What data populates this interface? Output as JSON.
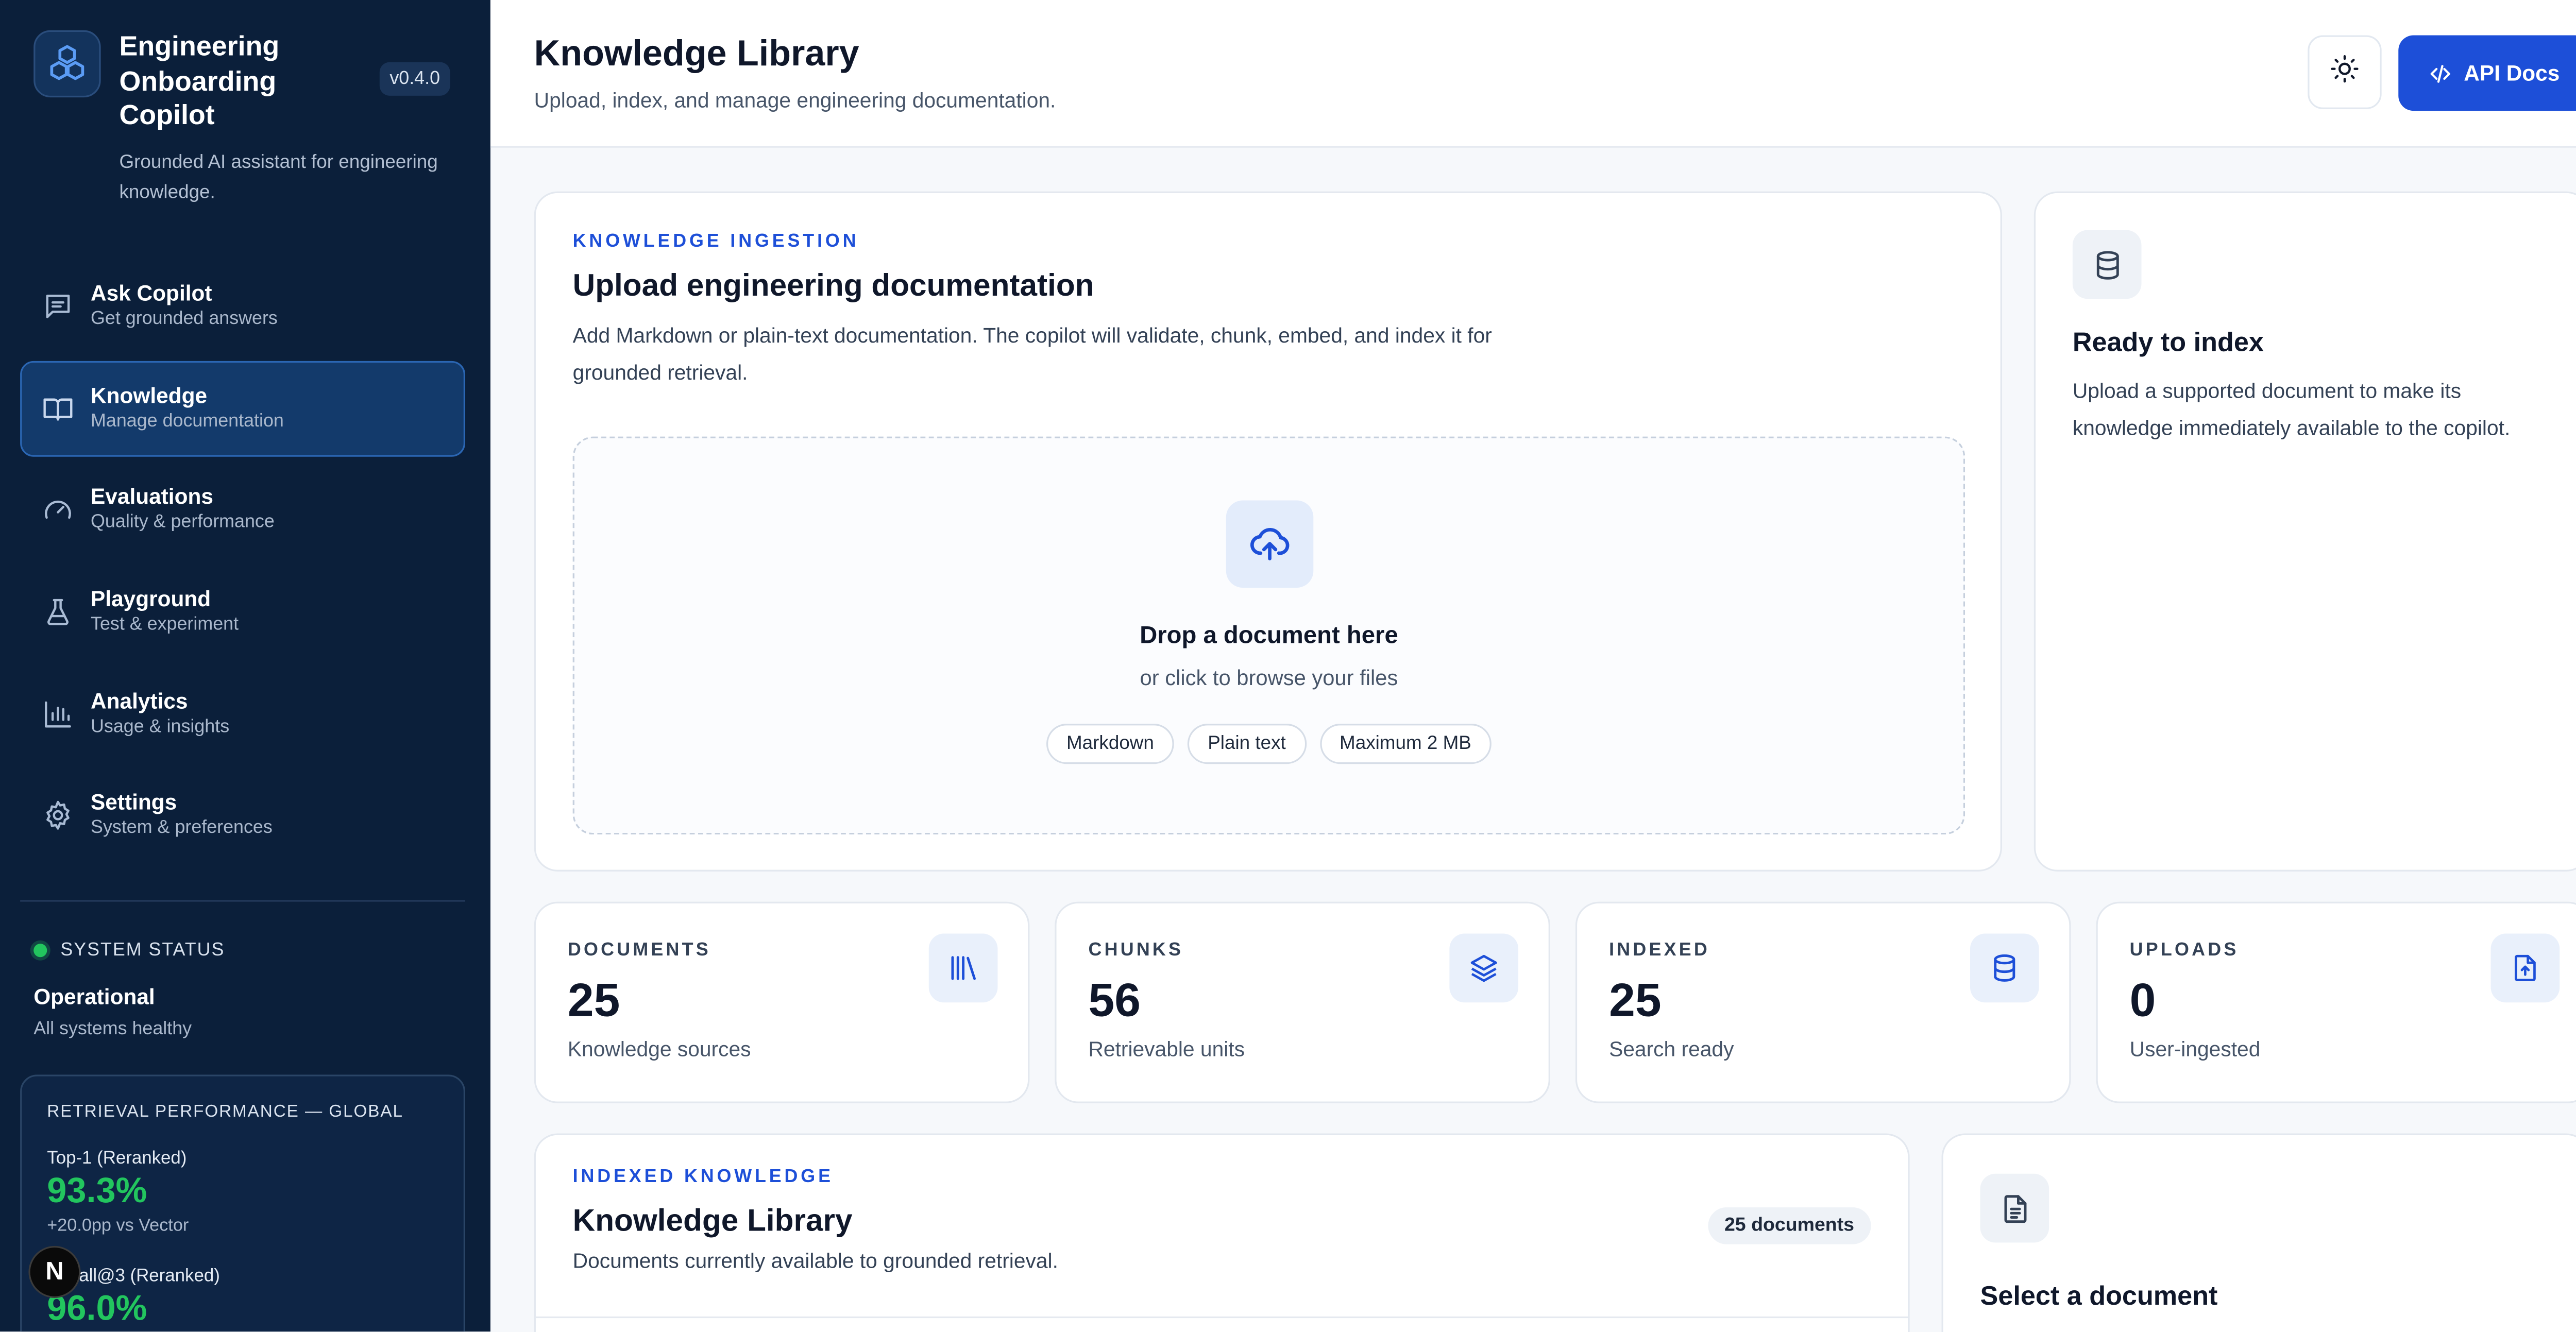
{
  "sidebar": {
    "app_title": "Engineering Onboarding Copilot",
    "version": "v0.4.0",
    "app_subtitle": "Grounded AI assistant for engineering knowledge.",
    "nav": [
      {
        "label": "Ask Copilot",
        "sub": "Get grounded answers",
        "icon": "chat-icon",
        "active": false
      },
      {
        "label": "Knowledge",
        "sub": "Manage documentation",
        "icon": "book-icon",
        "active": true
      },
      {
        "label": "Evaluations",
        "sub": "Quality & performance",
        "icon": "gauge-icon",
        "active": false
      },
      {
        "label": "Playground",
        "sub": "Test & experiment",
        "icon": "flask-icon",
        "active": false
      },
      {
        "label": "Analytics",
        "sub": "Usage & insights",
        "icon": "bar-chart-icon",
        "active": false
      },
      {
        "label": "Settings",
        "sub": "System & preferences",
        "icon": "gear-icon",
        "active": false
      }
    ],
    "status": {
      "heading": "SYSTEM STATUS",
      "value": "Operational",
      "detail": "All systems healthy",
      "color": "#22c55e"
    },
    "performance": {
      "title": "RETRIEVAL PERFORMANCE — GLOBAL",
      "metric1_label": "Top-1 (Reranked)",
      "metric1_value": "93.3%",
      "metric1_note": "+20.0pp vs Vector",
      "metric2_label": "Recall@3 (Reranked)",
      "metric2_value": "96.0%"
    },
    "badge_letter": "N"
  },
  "header": {
    "title": "Knowledge Library",
    "subtitle": "Upload, index, and manage engineering documentation.",
    "api_docs_label": "API Docs",
    "theme_icon": "sun-icon"
  },
  "upload": {
    "eyebrow": "KNOWLEDGE INGESTION",
    "title": "Upload engineering documentation",
    "description": "Add Markdown or plain-text documentation. The copilot will validate, chunk, embed, and index it for grounded retrieval.",
    "drop_title": "Drop a document here",
    "drop_sub": "or click to browse your files",
    "chips": [
      "Markdown",
      "Plain text",
      "Maximum 2 MB"
    ]
  },
  "ready": {
    "title": "Ready to index",
    "description": "Upload a supported document to make its knowledge immediately available to the copilot."
  },
  "stats": [
    {
      "label": "DOCUMENTS",
      "value": "25",
      "sub": "Knowledge sources",
      "icon": "library-icon"
    },
    {
      "label": "CHUNKS",
      "value": "56",
      "sub": "Retrievable units",
      "icon": "layers-icon"
    },
    {
      "label": "INDEXED",
      "value": "25",
      "sub": "Search ready",
      "icon": "database-icon"
    },
    {
      "label": "UPLOADS",
      "value": "0",
      "sub": "User-ingested",
      "icon": "file-upload-icon"
    }
  ],
  "library": {
    "eyebrow": "INDEXED KNOWLEDGE",
    "title": "Knowledge Library",
    "subtitle": "Documents currently available to grounded retrieval.",
    "count": "25 documents"
  },
  "select": {
    "title": "Select a document"
  },
  "colors": {
    "sidebar_bg": "#0b1f3a",
    "accent": "#1d4fd8",
    "success": "#22c55e"
  }
}
